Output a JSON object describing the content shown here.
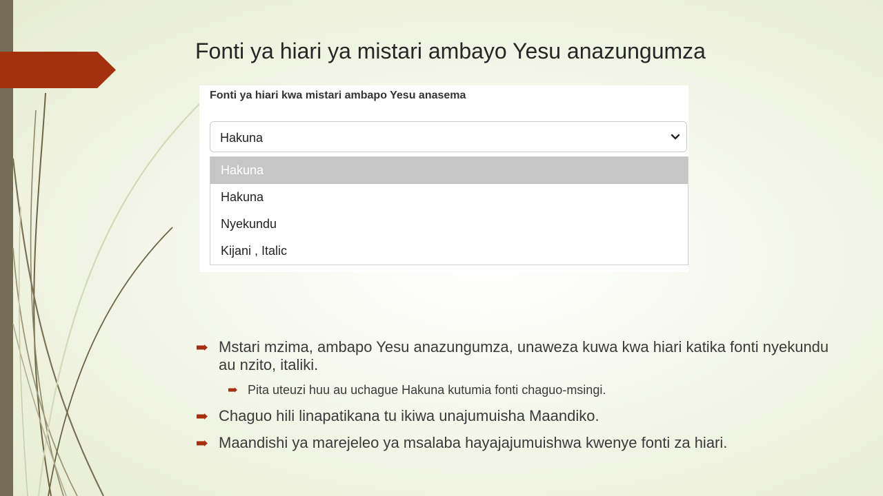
{
  "slide": {
    "title": "Fonti ya hiari ya mistari ambayo Yesu anazungumza"
  },
  "screenshot": {
    "label": "Fonti ya hiari kwa mistari ambapo Yesu anasema",
    "selected_value": "Hakuna",
    "options": [
      "Hakuna",
      "Hakuna",
      "Nyekundu",
      "Kijani , Italic"
    ],
    "highlighted_option": 0
  },
  "bullets": [
    "Mstari mzima, ambapo Yesu anazungumza, unaweza kuwa kwa hiari katika fonti nyekundu au nzito, italiki.",
    "Pita uteuzi huu au uchague Hakuna kutumia fonti chaguo-msingi.",
    "Chaguo hili linapatikana tu ikiwa unajumuisha Maandiko.",
    "Maandishi ya marejeleo ya msalaba hayajajumuishwa kwenye fonti za hiari."
  ],
  "colors": {
    "accent_arrow": "#a3300f",
    "left_bar": "#756c55",
    "bullet_marker": "#a3300f",
    "highlight_bg": "#c6c6c6"
  }
}
